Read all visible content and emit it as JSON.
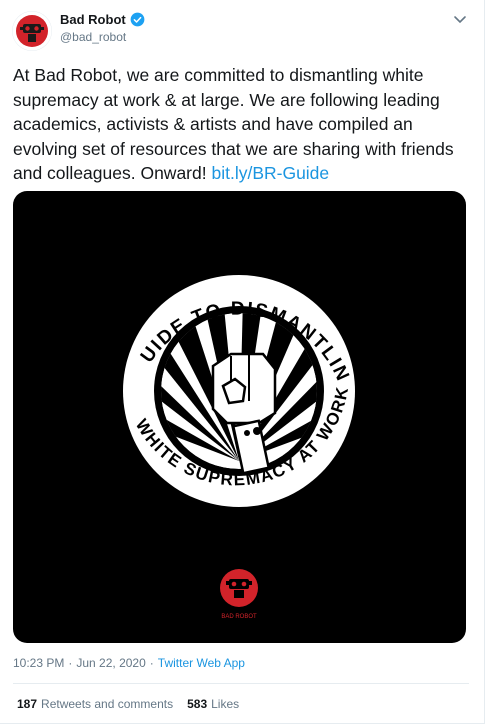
{
  "account": {
    "name": "Bad Robot",
    "handle": "@bad_robot",
    "verified": true,
    "avatar_icon": "bad-robot-logo-icon"
  },
  "tweet": {
    "text": "At Bad Robot, we are committed to dismantling white supremacy at work & at large. We are following leading academics, activists & artists and have compiled an evolving set of resources that we are sharing with friends and colleagues. Onward!",
    "link": "bit.ly/BR-Guide"
  },
  "media": {
    "circle_text_top": "GUIDE TO DISMANTLING",
    "circle_text_bottom": "WHITE SUPREMACY AT WORK",
    "logo_text": "BAD ROBOT",
    "background": "#000000",
    "logo_color": "#d2232a"
  },
  "meta": {
    "time": "10:23 PM",
    "sep1": "·",
    "date": "Jun 22, 2020",
    "sep2": "·",
    "app": "Twitter Web App"
  },
  "stats": {
    "retweets_count": "187",
    "retweets_label": "Retweets and comments",
    "likes_count": "583",
    "likes_label": "Likes"
  },
  "colors": {
    "link": "#1b95e0",
    "secondary_text": "#657786",
    "verified": "#1da1f2"
  }
}
